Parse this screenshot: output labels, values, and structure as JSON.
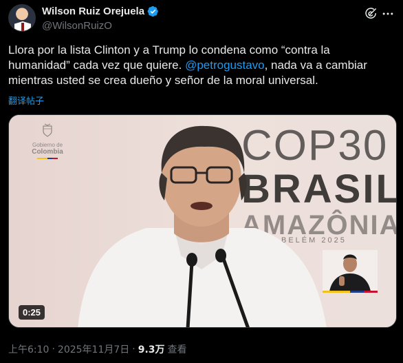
{
  "author": {
    "display_name": "Wilson Ruiz Orejuela",
    "handle": "@WilsonRuizO",
    "verified": true,
    "verified_color": "#1d9bf0"
  },
  "tweet": {
    "text_before": "Llora por la lista Clinton y a Trump lo condena como “contra la humanidad” cada vez que quiere. ",
    "mention": "@petrogustavo",
    "text_after": ", nada va a cambiar mientras usted se crea dueño y señor de la moral universal.",
    "translate_label": "翻译帖子"
  },
  "media": {
    "duration": "0:25",
    "logo_line1": "Gobierno de",
    "logo_line2": "Colombia",
    "backdrop_line1": "COP30",
    "backdrop_line2": "BRASIL",
    "backdrop_line3": "AMAZÔNIA",
    "backdrop_line4": "BELÉM 2025"
  },
  "meta": {
    "time": "上午6:10",
    "separator": "·",
    "date": "2025年11月7日",
    "views_count": "9.3万",
    "views_label": "查看"
  },
  "icons": {
    "verified": "verified-badge-icon",
    "grok": "grok-icon",
    "more": "more-icon"
  },
  "colors": {
    "background": "#000000",
    "accent": "#1d9bf0",
    "secondary_text": "#71767b",
    "primary_text": "#e7e9ea"
  }
}
